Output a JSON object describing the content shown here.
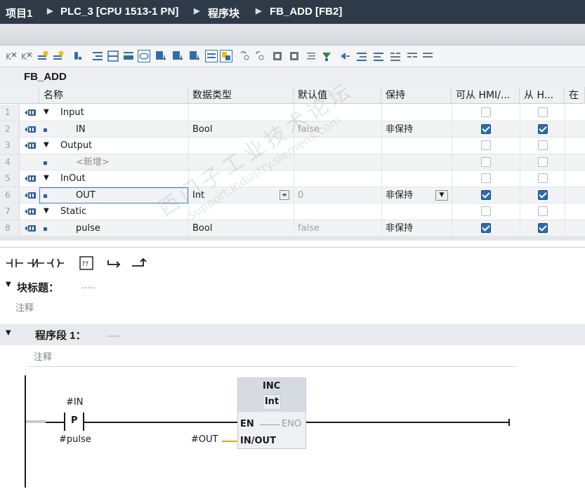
{
  "breadcrumb": {
    "project": "项目1",
    "plc": "PLC_3 [CPU 1513-1 PN]",
    "folder": "程序块",
    "block": "FB_ADD [FB2]"
  },
  "block_name": "FB_ADD",
  "table": {
    "headers": [
      "名称",
      "数据类型",
      "默认值",
      "保持",
      "可从 HMI/...",
      "从 H...",
      "在"
    ],
    "rows": [
      {
        "num": "1",
        "name": "Input",
        "type": "",
        "default": "",
        "retain": "",
        "hmi_access": false,
        "hmi_write": false,
        "section": true
      },
      {
        "num": "2",
        "name": "IN",
        "type": "Bool",
        "default": "false",
        "retain": "非保持",
        "hmi_access": true,
        "hmi_write": true,
        "section": false
      },
      {
        "num": "3",
        "name": "Output",
        "type": "",
        "default": "",
        "retain": "",
        "hmi_access": false,
        "hmi_write": false,
        "section": true
      },
      {
        "num": "4",
        "name": "<新增>",
        "type": "",
        "default": "",
        "retain": "",
        "hmi_access": false,
        "hmi_write": false,
        "section": false,
        "placeholder": true
      },
      {
        "num": "5",
        "name": "InOut",
        "type": "",
        "default": "",
        "retain": "",
        "hmi_access": false,
        "hmi_write": false,
        "section": true
      },
      {
        "num": "6",
        "name": "OUT",
        "type": "Int",
        "default": "0",
        "retain": "非保持",
        "hmi_access": true,
        "hmi_write": true,
        "section": false,
        "selected": true
      },
      {
        "num": "7",
        "name": "Static",
        "type": "",
        "default": "",
        "retain": "",
        "hmi_access": false,
        "hmi_write": false,
        "section": true
      },
      {
        "num": "8",
        "name": "pulse",
        "type": "Bool",
        "default": "false",
        "retain": "非保持",
        "hmi_access": true,
        "hmi_write": true,
        "section": false
      }
    ]
  },
  "block_title": {
    "label": "块标题：",
    "value": ".....",
    "comment": "注释"
  },
  "network": {
    "label": "程序段 1：",
    "value": ".....",
    "comment": "注释"
  },
  "ladder": {
    "contact_operand": "#IN",
    "contact_symbol": "P",
    "contact_memory": "#pulse",
    "box_name": "INC",
    "box_type": "Int",
    "en": "EN",
    "eno": "ENO",
    "inout_pin": "IN/OUT",
    "inout_operand": "#OUT"
  },
  "watermark": {
    "line1": "西门子工业技术论坛",
    "line2": "support.industry.siemens.com"
  },
  "colors": {
    "title_bar": "#2e3a48",
    "checkbox_on": "#2a6bb3",
    "operand_line": "#e8a400",
    "box_header": "#d6dbe2"
  },
  "icons": [
    "chevron-right-icon",
    "toolbar-icons",
    "interface-section-icon",
    "no-contact-icon",
    "nc-contact-icon",
    "coil-icon",
    "empty-box-icon",
    "open-branch-icon",
    "close-branch-icon"
  ]
}
